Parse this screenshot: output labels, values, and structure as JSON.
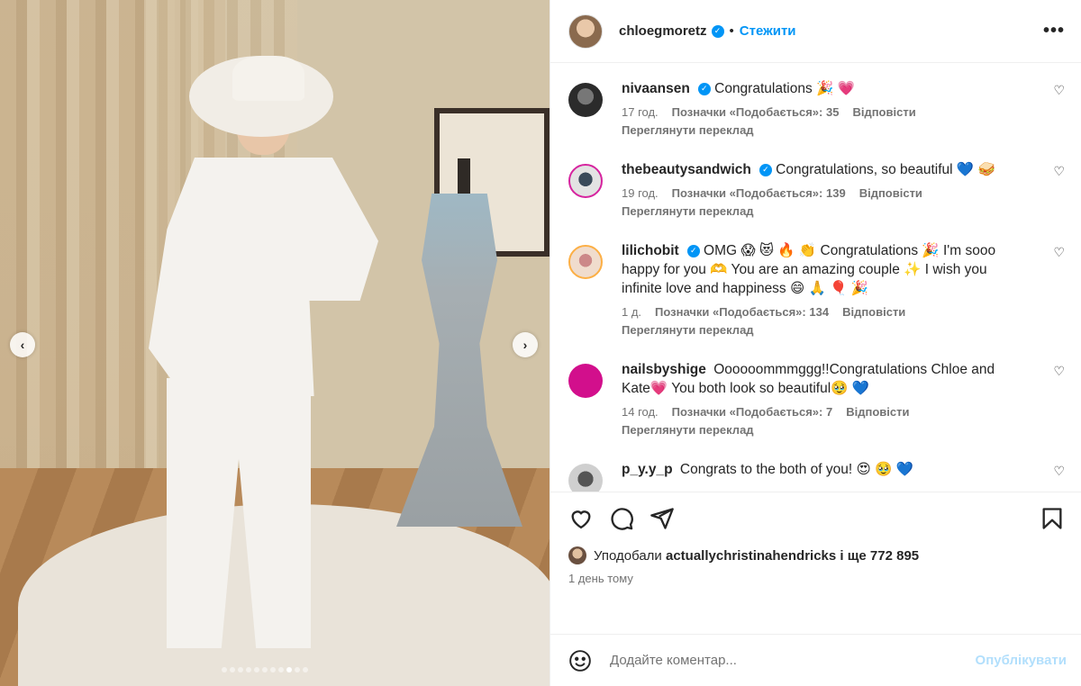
{
  "post": {
    "author": "chloegmoretz",
    "separator": "•",
    "follow_label": "Стежити",
    "more_label": "•••",
    "carousel": {
      "dots": 11,
      "active_index": 8,
      "prev_label": "‹",
      "next_label": "›"
    }
  },
  "comments": [
    {
      "user": "nivaansen",
      "verified": true,
      "text": "Congratulations 🎉 💗",
      "time": "17 год.",
      "likes": "Позначки «Подобається»: 35",
      "reply": "Відповісти",
      "translate": "Переглянути переклад"
    },
    {
      "user": "thebeautysandwich",
      "verified": true,
      "text": "Congratulations, so beautiful 💙 🥪",
      "time": "19 год.",
      "likes": "Позначки «Подобається»: 139",
      "reply": "Відповісти",
      "translate": "Переглянути переклад"
    },
    {
      "user": "lilichobit",
      "verified": true,
      "text": "OMG 😱 😻 🔥 👏 Congratulations 🎉 I'm sooo happy for you 🫶 You are an amazing couple ✨ I wish you infinite love and happiness 😄 🙏 🎈 🎉",
      "time": "1 д.",
      "likes": "Позначки «Подобається»: 134",
      "reply": "Відповісти",
      "translate": "Переглянути переклад"
    },
    {
      "user": "nailsbyshige",
      "verified": false,
      "text": "Oooooommmggg!!Congratulations Chloe and Kate💗 You both look so beautiful🥹 💙",
      "time": "14 год.",
      "likes": "Позначки «Подобається»: 7",
      "reply": "Відповісти",
      "translate": "Переглянути переклад"
    },
    {
      "user": "p_y.y_p",
      "verified": false,
      "text": "Congrats to the both of you! 😍 🥹 💙",
      "time": "",
      "likes": "",
      "reply": "",
      "translate": ""
    }
  ],
  "liked_by": {
    "prefix": "Уподобали",
    "user": "actuallychristinahendricks",
    "suffix": "і ще 772 895"
  },
  "timestamp": "1 день тому",
  "composer": {
    "placeholder": "Додайте коментар...",
    "post_label": "Опублікувати"
  },
  "icons": {
    "like": "heart-icon",
    "comment": "comment-icon",
    "share": "share-icon",
    "save": "bookmark-icon",
    "emoji": "smile-icon"
  },
  "colors": {
    "accent": "#0095f6",
    "post_disabled": "#b2dffc",
    "muted": "#737373"
  }
}
